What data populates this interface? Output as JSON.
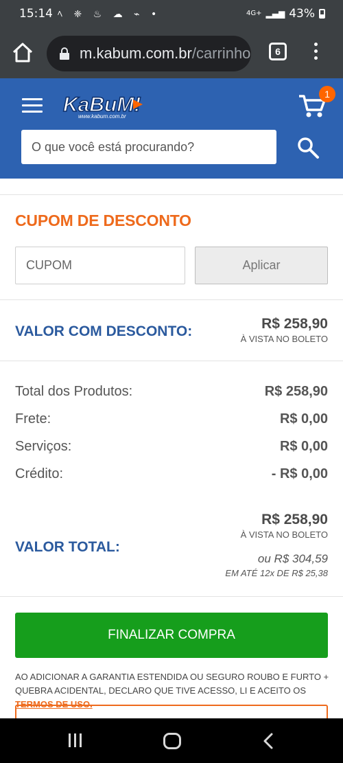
{
  "status_bar": {
    "time": "15:14",
    "notification_icons": "ﾍ ❈ ♨ ☁ ⌁ •",
    "network": "4G+",
    "battery": "43%"
  },
  "browser": {
    "url_host": "m.kabum.com.br",
    "url_path": "/carrinho",
    "tab_count": "6"
  },
  "header": {
    "logo_text": "KaBuM!",
    "logo_subtext": "www.kabum.com.br",
    "cart_count": "1",
    "search_placeholder": "O que você está procurando?"
  },
  "coupon": {
    "title": "CUPOM DE DESCONTO",
    "input_placeholder": "CUPOM",
    "apply_label": "Aplicar"
  },
  "discount": {
    "label": "VALOR COM DESCONTO:",
    "value": "R$ 258,90",
    "note": "À VISTA NO BOLETO"
  },
  "summary": [
    {
      "label": "Total dos Produtos:",
      "value": "R$ 258,90"
    },
    {
      "label": "Frete:",
      "value": "R$ 0,00"
    },
    {
      "label": "Serviços:",
      "value": "R$ 0,00"
    },
    {
      "label": "Crédito:",
      "value": "- R$ 0,00"
    }
  ],
  "total": {
    "label": "VALOR TOTAL:",
    "value": "R$ 258,90",
    "note": "À VISTA NO BOLETO",
    "installment_value": "ou R$ 304,59",
    "installment_note": "EM ATÉ 12x DE R$ 25,38"
  },
  "checkout": {
    "button_label": "FINALIZAR COMPRA",
    "legal_text": "AO ADICIONAR A GARANTIA ESTENDIDA OU SEGURO ROUBO E FURTO + QUEBRA ACIDENTAL, DECLARO QUE TIVE ACESSO, LI E ACEITO OS",
    "legal_link": "TERMOS DE USO."
  },
  "colors": {
    "header_blue": "#2d62b1",
    "accent_orange": "#ee6a1c",
    "label_blue": "#2b5a9e",
    "checkout_green": "#169e1c",
    "browser_dark": "#3c4043"
  },
  "icons": [
    "home-icon",
    "lock-icon",
    "tabs-icon",
    "overflow-menu-icon",
    "hamburger-icon",
    "cart-icon",
    "search-icon",
    "recents-icon",
    "home-nav-icon",
    "back-icon"
  ]
}
